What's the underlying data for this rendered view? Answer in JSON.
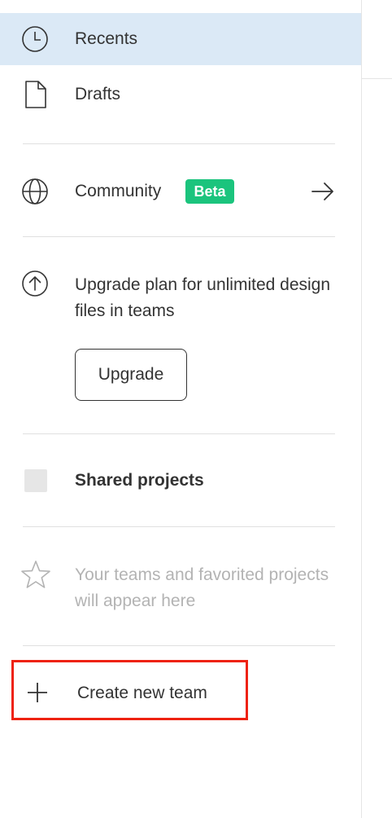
{
  "sidebar": {
    "nav": {
      "recents": {
        "label": "Recents",
        "icon": "clock-icon"
      },
      "drafts": {
        "label": "Drafts",
        "icon": "file-icon"
      }
    },
    "community": {
      "label": "Community",
      "badge": "Beta",
      "badge_color": "#1bc47d",
      "icon": "globe-icon",
      "arrow_icon": "arrow-right-icon"
    },
    "upgrade": {
      "text": "Upgrade plan for unlimited design files in teams",
      "button_label": "Upgrade",
      "icon": "arrow-up-circle-icon"
    },
    "shared_projects": {
      "label": "Shared projects"
    },
    "teams_empty": {
      "text": "Your teams and favorited projects will appear here",
      "icon": "star-icon"
    },
    "create_team": {
      "label": "Create new team",
      "icon": "plus-icon",
      "highlight_color": "#ee2211"
    },
    "selected_color": "#dbe9f6"
  }
}
